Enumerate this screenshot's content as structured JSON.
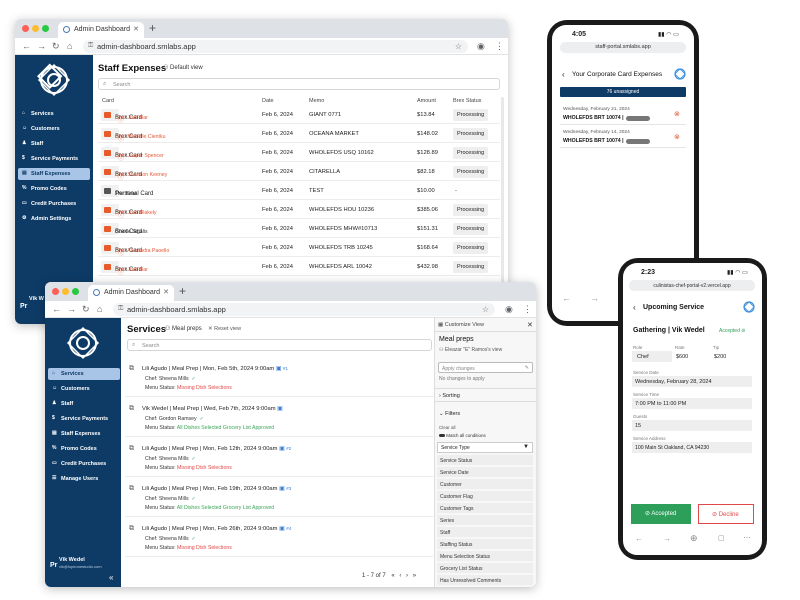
{
  "expenses_window": {
    "tab_title": "Admin Dashboard",
    "url": "admin-dashboard.smlabs.app",
    "sidebar": {
      "items": [
        {
          "label": "Services",
          "icon": "home-icon"
        },
        {
          "label": "Customers",
          "icon": "users-icon"
        },
        {
          "label": "Staff",
          "icon": "staff-icon"
        },
        {
          "label": "Service Payments",
          "icon": "payments-icon"
        },
        {
          "label": "Staff Expenses",
          "icon": "expenses-icon"
        },
        {
          "label": "Promo Codes",
          "icon": "promo-icon"
        },
        {
          "label": "Credit Purchases",
          "icon": "credit-icon"
        },
        {
          "label": "Admin Settings",
          "icon": "settings-icon"
        }
      ],
      "active_index": 4,
      "user_name": "Vik W",
      "user_initial": "Pr"
    },
    "page_title": "Staff Expenses",
    "view_label": "Default view",
    "search_placeholder": "Search",
    "columns": [
      "Card",
      "Date",
      "Memo",
      "Amount",
      "Brex Status"
    ],
    "rows": [
      {
        "card": "Brex Card",
        "chef": "Chef Josh Bar",
        "warn": true,
        "date": "Feb 6, 2024",
        "memo": "GIANT 0771",
        "amount": "$13.84",
        "status": "Processing"
      },
      {
        "card": "Brex Card",
        "chef": "Chef Michelle Cientku",
        "warn": true,
        "date": "Feb 6, 2024",
        "memo": "OCEANA MARKET",
        "amount": "$148.02",
        "status": "Processing"
      },
      {
        "card": "Brex Card",
        "chef": "Chef Jasper Spencer",
        "warn": true,
        "date": "Feb 6, 2024",
        "memo": "WHOLEFDS USQ 10162",
        "amount": "$128.89",
        "status": "Processing"
      },
      {
        "card": "Brex Card",
        "chef": "Chef Shannon Keeney",
        "warn": true,
        "date": "Feb 6, 2024",
        "memo": "CITARELLA",
        "amount": "$82.18",
        "status": "Processing"
      },
      {
        "card": "Personal Card",
        "chef": "The Bear",
        "warn": false,
        "date": "Feb 6, 2024",
        "memo": "TEST",
        "amount": "$10.00",
        "status": "-"
      },
      {
        "card": "Brex Card",
        "chef": "Chef Josh Blakely",
        "warn": true,
        "date": "Feb 6, 2024",
        "memo": "WHOLEFDS HOU 10236",
        "amount": "$385.06",
        "status": "Processing"
      },
      {
        "card": "Brex Card",
        "chef": "Giselle Sigalis",
        "warn": false,
        "date": "Feb 6, 2024",
        "memo": "WHOLEFDS MHW#10713",
        "amount": "$151.31",
        "status": "Processing"
      },
      {
        "card": "Brex Card",
        "chef": "Chef Alexandra Paoello",
        "warn": true,
        "date": "Feb 6, 2024",
        "memo": "WHOLEFDS TRB 10245",
        "amount": "$168.64",
        "status": "Processing"
      },
      {
        "card": "Brex Card",
        "chef": "Chef Josh Bar",
        "warn": true,
        "date": "Feb 6, 2024",
        "memo": "WHOLEFDS ARL 10042",
        "amount": "$432.98",
        "status": "Processing"
      }
    ]
  },
  "services_window": {
    "tab_title": "Admin Dashboard",
    "url": "admin-dashboard.smlabs.app",
    "sidebar": {
      "items": [
        {
          "label": "Services",
          "icon": "home-icon"
        },
        {
          "label": "Customers",
          "icon": "users-icon"
        },
        {
          "label": "Staff",
          "icon": "staff-icon"
        },
        {
          "label": "Service Payments",
          "icon": "payments-icon"
        },
        {
          "label": "Staff Expenses",
          "icon": "expenses-icon"
        },
        {
          "label": "Promo Codes",
          "icon": "promo-icon"
        },
        {
          "label": "Credit Purchases",
          "icon": "credit-icon"
        },
        {
          "label": "Manage Users",
          "icon": "manage-users-icon"
        }
      ],
      "active_index": 0,
      "user_name": "Vik Wedel",
      "user_email": "vik@lopeonestudio.com",
      "user_initial": "Pr",
      "collapse_label": "«"
    },
    "page_title": "Services",
    "view_label": "Meal preps",
    "reset_label": "Reset view",
    "search_placeholder": "Search",
    "services": [
      {
        "client": "Lili Agudo",
        "type": "Meal Prep",
        "when": "Mon, Feb 5th, 2024 9:00am",
        "tag": "#1",
        "chef": "Chef: Sheena Mills",
        "menu_label": "Menu Status:",
        "menu_status": "Missing Dish Selections",
        "status_ok": false
      },
      {
        "client": "Vik Wedel",
        "type": "Meal Prep",
        "when": "Wed, Feb 7th, 2024 9:00am",
        "tag": "",
        "chef": "Chef: Gordon Ramsey",
        "menu_label": "Menu Status:",
        "menu_status": "All Dishes Selected  Grocery List Approved",
        "status_ok": true
      },
      {
        "client": "Lili Agudo",
        "type": "Meal Prep",
        "when": "Mon, Feb 12th, 2024 9:00am",
        "tag": "#2",
        "chef": "Chef: Sheena Mills",
        "menu_label": "Menu Status:",
        "menu_status": "Missing Dish Selections",
        "status_ok": false
      },
      {
        "client": "Lili Agudo",
        "type": "Meal Prep",
        "when": "Mon, Feb 19th, 2024 9:00am",
        "tag": "#3",
        "chef": "Chef: Sheena Mills",
        "menu_label": "Menu Status:",
        "menu_status": "All Dishes Selected  Grocery List Approved",
        "status_ok": true
      },
      {
        "client": "Lili Agudo",
        "type": "Meal Prep",
        "when": "Mon, Feb 26th, 2024 9:00am",
        "tag": "#4",
        "chef": "Chef: Sheena Mills",
        "menu_label": "Menu Status:",
        "menu_status": "Missing Dish Selections",
        "status_ok": false
      }
    ],
    "pagination": "1 - 7 of 7",
    "customize": {
      "header": "Customize View",
      "view_name": "Meal preps",
      "owner": "Eleazar \"E\" Ramos's view",
      "apply_label": "Apply changes",
      "no_changes": "No changes to apply",
      "sorting": "Sorting",
      "filters": "Filters",
      "clear_all": "Clear all",
      "match_all": "Match all conditions",
      "filter_field": "Service Type",
      "fields": [
        "Service Status",
        "Service Date",
        "Customer",
        "Customer Flag",
        "Customer Tags",
        "Series",
        "Staff",
        "Staffing Status",
        "Menu Selection Status",
        "Grocery List Status",
        "Has Unresolved Comments"
      ]
    }
  },
  "phone_left": {
    "time": "4:05",
    "url": "staff-portal.smlabs.app",
    "title": "Your Corporate Card Expenses",
    "unassigned": "76 unassigned",
    "expenses": [
      {
        "date": "Wednesday, February 21, 2024",
        "merchant": "WHOLEFDS BRT 10074 |"
      },
      {
        "date": "Wednesday, February 14, 2024",
        "merchant": "WHOLEFDS BRT 10074 |"
      }
    ]
  },
  "phone_right": {
    "time": "2:23",
    "url": "culinistas-chef-portal-v2.vercel.app",
    "title": "Upcoming Service",
    "event": "Gathering | Vik Wedel",
    "accepted_badge": "Accepted",
    "role_label": "Role",
    "role": "Chef",
    "rate_label": "Rate",
    "rate": "$600",
    "tip_label": "Tip",
    "tip": "$200",
    "date_label": "Service Date",
    "date": "Wednesday, February 28, 2024",
    "time_label": "Service Time",
    "time_range": "7:00 PM to 11:00 PM",
    "guests_label": "Guests",
    "guests": "15",
    "address_label": "Service Address",
    "address": "100 Main St Oakland, CA 94230",
    "accept_button": "Accepted",
    "decline_button": "Decline"
  },
  "colors": {
    "sidebar": "#0d3b66",
    "accent": "#0d3b66",
    "warning": "#e25a3a",
    "success": "#3aa55a",
    "accept_green": "#2e9e5b",
    "decline_red": "#e0484a"
  }
}
